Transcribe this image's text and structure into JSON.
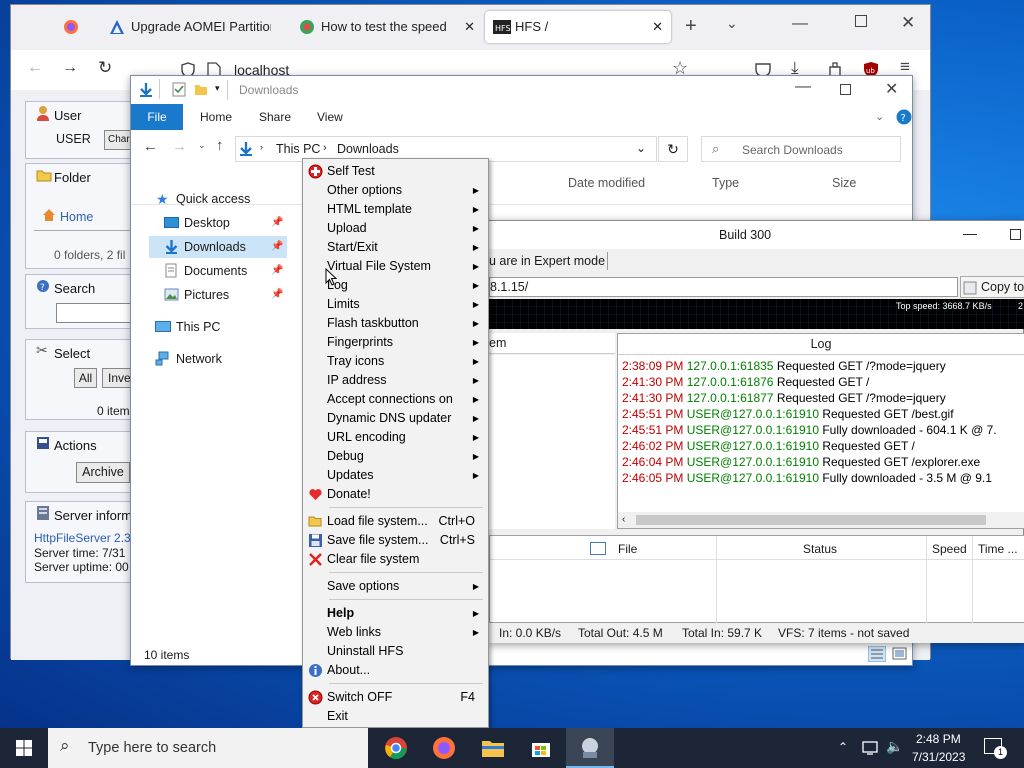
{
  "browser": {
    "tabs": [
      {
        "label": ""
      },
      {
        "label": "Upgrade AOMEI Partition"
      },
      {
        "label": "How to test the speed of"
      },
      {
        "label": "HFS /"
      }
    ],
    "address": "localhost"
  },
  "hfs_page": {
    "user_title": "User",
    "user_name": "USER",
    "change_btn": "Char",
    "folder_title": "Folder",
    "home_link": "Home",
    "folder_info": "0 folders, 2 fil",
    "search_title": "Search",
    "select_title": "Select",
    "all_btn": "All",
    "invert_btn": "Inve",
    "items_info": "0 items",
    "actions_title": "Actions",
    "archive_btn": "Archive",
    "server_title": "Server inform",
    "server_link": "HttpFileServer 2.3",
    "server_time": "Server time: 7/31",
    "server_uptime": "Server uptime: 00"
  },
  "explorer": {
    "title": "Downloads",
    "ribbon_tabs": [
      "File",
      "Home",
      "Share",
      "View"
    ],
    "breadcrumb": [
      "This PC",
      "Downloads"
    ],
    "search_placeholder": "Search Downloads",
    "columns": [
      "Date modified",
      "Type",
      "Size"
    ],
    "nav": [
      {
        "label": "Quick access"
      },
      {
        "label": "Desktop"
      },
      {
        "label": "Downloads"
      },
      {
        "label": "Documents"
      },
      {
        "label": "Pictures"
      },
      {
        "label": "This PC"
      },
      {
        "label": "Network"
      }
    ],
    "status": "10 items"
  },
  "hfs_app": {
    "title": "Build 300",
    "mode_text": "u are in Expert mode",
    "url": "8.1.15/",
    "copy_btn": "Copy to",
    "top_speed": "Top speed: 3668.7 KB/s",
    "top_speed_extra": "2",
    "col_item": "em",
    "log_header": "Log",
    "log": [
      {
        "time": "2:38:09 PM",
        "ip": "127.0.0.1:61835",
        "msg": "Requested GET /?mode=jquery"
      },
      {
        "time": "2:41:30 PM",
        "ip": "127.0.0.1:61876",
        "msg": "Requested GET /"
      },
      {
        "time": "2:41:30 PM",
        "ip": "127.0.0.1:61877",
        "msg": "Requested GET /?mode=jquery"
      },
      {
        "time": "2:45:51 PM",
        "ip": "USER@127.0.0.1:61910",
        "msg": "Requested GET /best.gif"
      },
      {
        "time": "2:45:51 PM",
        "ip": "USER@127.0.0.1:61910",
        "msg": "Fully downloaded - 604.1 K @ 7."
      },
      {
        "time": "2:46:02 PM",
        "ip": "USER@127.0.0.1:61910",
        "msg": "Requested GET /"
      },
      {
        "time": "2:46:04 PM",
        "ip": "USER@127.0.0.1:61910",
        "msg": "Requested GET /explorer.exe"
      },
      {
        "time": "2:46:05 PM",
        "ip": "USER@127.0.0.1:61910",
        "msg": "Fully downloaded - 3.5 M @ 9.1"
      }
    ],
    "transfer_cols": [
      "File",
      "Status",
      "Speed",
      "Time ..."
    ],
    "status": {
      "in": "In: 0.0 KB/s",
      "total_out": "Total Out: 4.5 M",
      "total_in": "Total In: 59.7 K",
      "vfs": "VFS: 7 items - not saved"
    }
  },
  "menu": {
    "items": [
      {
        "label": "Self Test",
        "arrow": false,
        "shortcut": ""
      },
      {
        "label": "Other options",
        "arrow": true,
        "shortcut": ""
      },
      {
        "label": "HTML template",
        "arrow": true,
        "shortcut": ""
      },
      {
        "label": "Upload",
        "arrow": true,
        "shortcut": ""
      },
      {
        "label": "Start/Exit",
        "arrow": true,
        "shortcut": ""
      },
      {
        "label": "Virtual File System",
        "arrow": true,
        "shortcut": ""
      },
      {
        "label": "Log",
        "arrow": true,
        "shortcut": ""
      },
      {
        "label": "Limits",
        "arrow": true,
        "shortcut": ""
      },
      {
        "label": "Flash taskbutton",
        "arrow": true,
        "shortcut": ""
      },
      {
        "label": "Fingerprints",
        "arrow": true,
        "shortcut": ""
      },
      {
        "label": "Tray icons",
        "arrow": true,
        "shortcut": ""
      },
      {
        "label": "IP address",
        "arrow": true,
        "shortcut": ""
      },
      {
        "label": "Accept connections on",
        "arrow": true,
        "shortcut": ""
      },
      {
        "label": "Dynamic DNS updater",
        "arrow": true,
        "shortcut": ""
      },
      {
        "label": "URL encoding",
        "arrow": true,
        "shortcut": ""
      },
      {
        "label": "Debug",
        "arrow": true,
        "shortcut": ""
      },
      {
        "label": "Updates",
        "arrow": true,
        "shortcut": ""
      },
      {
        "label": "Donate!",
        "arrow": false,
        "shortcut": ""
      },
      {
        "label": "Load file system...",
        "arrow": false,
        "shortcut": "Ctrl+O"
      },
      {
        "label": "Save file system...",
        "arrow": false,
        "shortcut": "Ctrl+S"
      },
      {
        "label": "Clear file system",
        "arrow": false,
        "shortcut": ""
      },
      {
        "label": "Save options",
        "arrow": true,
        "shortcut": ""
      },
      {
        "label": "Help",
        "arrow": true,
        "shortcut": ""
      },
      {
        "label": "Web links",
        "arrow": true,
        "shortcut": ""
      },
      {
        "label": "Uninstall HFS",
        "arrow": false,
        "shortcut": ""
      },
      {
        "label": "About...",
        "arrow": false,
        "shortcut": ""
      },
      {
        "label": "Switch OFF",
        "arrow": false,
        "shortcut": "F4"
      },
      {
        "label": "Exit",
        "arrow": false,
        "shortcut": ""
      }
    ]
  },
  "taskbar": {
    "search_placeholder": "Type here to search",
    "time": "2:48 PM",
    "date": "7/31/2023",
    "notification_count": "1"
  },
  "colors": {
    "accent": "#1979ca",
    "log_time": "#c00000",
    "log_ip": "#008000",
    "taskbar": "#1c2637"
  }
}
